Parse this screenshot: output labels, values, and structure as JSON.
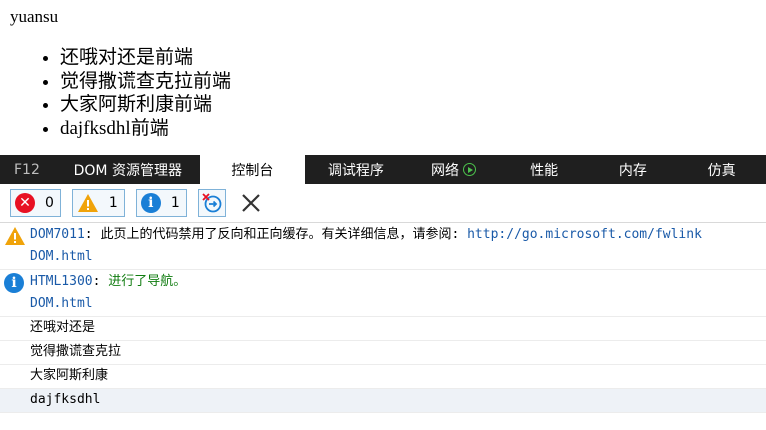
{
  "page": {
    "title": "yuansu",
    "list_items": [
      "还哦对还是前端",
      "觉得撒谎查克拉前端",
      "大家阿斯利康前端",
      "dajfksdhl前端"
    ]
  },
  "devtools": {
    "f12_label": "F12",
    "tabs": [
      {
        "label": "DOM 资源管理器",
        "active": false
      },
      {
        "label": "控制台",
        "active": true
      },
      {
        "label": "调试程序",
        "active": false
      },
      {
        "label": "网络",
        "active": false
      },
      {
        "label": "性能",
        "active": false
      },
      {
        "label": "内存",
        "active": false
      },
      {
        "label": "仿真",
        "active": false
      }
    ],
    "toolbar": {
      "error_count": "0",
      "warning_count": "1",
      "info_count": "1"
    },
    "console": {
      "warning": {
        "code": "DOM7011",
        "separator": ": ",
        "message": "此页上的代码禁用了反向和正向缓存。有关详细信息，请参阅: ",
        "link": "http://go.microsoft.com/fwlink",
        "source": "DOM.html"
      },
      "info": {
        "code": "HTML1300",
        "separator": ": ",
        "message": "进行了导航。",
        "source": "DOM.html"
      },
      "logs": [
        "还哦对还是",
        "觉得撒谎查克拉",
        "大家阿斯利康",
        "dajfksdhl"
      ]
    },
    "colors": {
      "tabbar_bg": "#1f1f1f",
      "error": "#e81123",
      "warning": "#f0a30a",
      "info": "#1a7fd6",
      "link": "#1a5aa8",
      "info_message": "#107c10"
    }
  }
}
